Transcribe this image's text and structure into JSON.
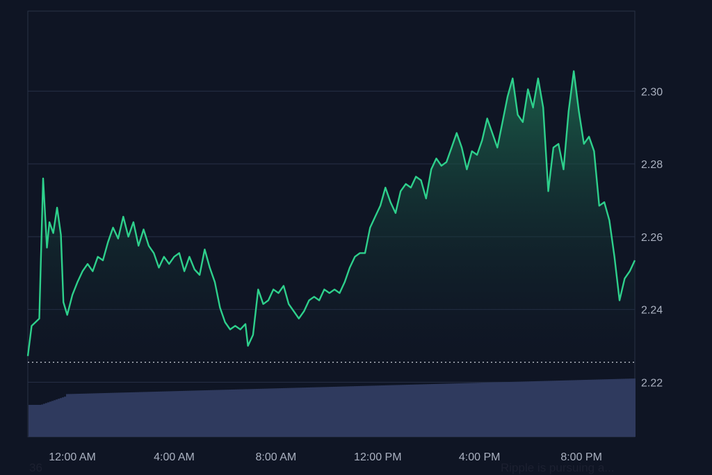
{
  "chart_data": {
    "type": "area",
    "title": "",
    "xlabel": "",
    "ylabel": "",
    "x_tick_labels": [
      "12:00 AM",
      "4:00 AM",
      "8:00 AM",
      "12:00 PM",
      "4:00 PM",
      "8:00 PM"
    ],
    "x_ticks_hours": [
      0,
      4,
      8,
      12,
      16,
      20
    ],
    "x_range_hours": [
      -1.75,
      22.1
    ],
    "ylim": [
      2.205,
      2.322
    ],
    "y_ticks": [
      "2.22",
      "2.24",
      "2.26",
      "2.28",
      "2.30"
    ],
    "y_tick_values": [
      2.22,
      2.24,
      2.26,
      2.28,
      2.3
    ],
    "reference_line": 2.2255,
    "grid": "horizontal",
    "line_color": "#2ed08c",
    "area_color": "#1a5a44",
    "volume_color": "#2f3a5e",
    "series": [
      {
        "values": [
          [
            -1.75,
            2.2272
          ],
          [
            -1.6,
            2.2355
          ],
          [
            -1.45,
            2.2365
          ],
          [
            -1.3,
            2.2375
          ],
          [
            -1.15,
            2.276
          ],
          [
            -1.0,
            2.257
          ],
          [
            -0.9,
            2.264
          ],
          [
            -0.75,
            2.261
          ],
          [
            -0.6,
            2.268
          ],
          [
            -0.45,
            2.2605
          ],
          [
            -0.35,
            2.242
          ],
          [
            -0.2,
            2.2385
          ],
          [
            0.0,
            2.244
          ],
          [
            0.2,
            2.2475
          ],
          [
            0.4,
            2.2505
          ],
          [
            0.6,
            2.2525
          ],
          [
            0.8,
            2.2505
          ],
          [
            1.0,
            2.2545
          ],
          [
            1.2,
            2.2535
          ],
          [
            1.4,
            2.2585
          ],
          [
            1.6,
            2.2625
          ],
          [
            1.8,
            2.2595
          ],
          [
            2.0,
            2.2655
          ],
          [
            2.2,
            2.26
          ],
          [
            2.4,
            2.264
          ],
          [
            2.6,
            2.2575
          ],
          [
            2.8,
            2.262
          ],
          [
            3.0,
            2.2575
          ],
          [
            3.2,
            2.2555
          ],
          [
            3.4,
            2.2515
          ],
          [
            3.6,
            2.2545
          ],
          [
            3.8,
            2.2525
          ],
          [
            4.0,
            2.2545
          ],
          [
            4.2,
            2.2555
          ],
          [
            4.4,
            2.2505
          ],
          [
            4.6,
            2.2545
          ],
          [
            4.8,
            2.251
          ],
          [
            5.0,
            2.2495
          ],
          [
            5.2,
            2.2565
          ],
          [
            5.4,
            2.2515
          ],
          [
            5.6,
            2.2475
          ],
          [
            5.8,
            2.2405
          ],
          [
            6.0,
            2.2365
          ],
          [
            6.2,
            2.2345
          ],
          [
            6.4,
            2.2355
          ],
          [
            6.6,
            2.2345
          ],
          [
            6.8,
            2.236
          ],
          [
            6.9,
            2.23
          ],
          [
            7.1,
            2.233
          ],
          [
            7.3,
            2.2455
          ],
          [
            7.5,
            2.2415
          ],
          [
            7.7,
            2.2425
          ],
          [
            7.9,
            2.2455
          ],
          [
            8.1,
            2.2445
          ],
          [
            8.3,
            2.2465
          ],
          [
            8.5,
            2.2415
          ],
          [
            8.7,
            2.2395
          ],
          [
            8.9,
            2.2375
          ],
          [
            9.1,
            2.2395
          ],
          [
            9.3,
            2.2425
          ],
          [
            9.5,
            2.2435
          ],
          [
            9.7,
            2.2425
          ],
          [
            9.9,
            2.2455
          ],
          [
            10.1,
            2.2445
          ],
          [
            10.3,
            2.2455
          ],
          [
            10.5,
            2.2445
          ],
          [
            10.7,
            2.2475
          ],
          [
            10.9,
            2.2515
          ],
          [
            11.1,
            2.2545
          ],
          [
            11.3,
            2.2555
          ],
          [
            11.5,
            2.2555
          ],
          [
            11.7,
            2.2625
          ],
          [
            11.9,
            2.2655
          ],
          [
            12.1,
            2.2685
          ],
          [
            12.3,
            2.2735
          ],
          [
            12.5,
            2.2695
          ],
          [
            12.7,
            2.2665
          ],
          [
            12.9,
            2.2725
          ],
          [
            13.1,
            2.2745
          ],
          [
            13.3,
            2.2735
          ],
          [
            13.5,
            2.2765
          ],
          [
            13.7,
            2.2755
          ],
          [
            13.9,
            2.2705
          ],
          [
            14.1,
            2.2785
          ],
          [
            14.3,
            2.2815
          ],
          [
            14.5,
            2.2795
          ],
          [
            14.7,
            2.2805
          ],
          [
            14.9,
            2.2845
          ],
          [
            15.1,
            2.2885
          ],
          [
            15.3,
            2.2845
          ],
          [
            15.5,
            2.2785
          ],
          [
            15.7,
            2.2835
          ],
          [
            15.9,
            2.2825
          ],
          [
            16.1,
            2.2865
          ],
          [
            16.3,
            2.2925
          ],
          [
            16.5,
            2.2885
          ],
          [
            16.7,
            2.2845
          ],
          [
            16.9,
            2.2915
          ],
          [
            17.1,
            2.2985
          ],
          [
            17.3,
            2.3035
          ],
          [
            17.5,
            2.2935
          ],
          [
            17.7,
            2.2915
          ],
          [
            17.9,
            2.3005
          ],
          [
            18.1,
            2.2955
          ],
          [
            18.3,
            2.3035
          ],
          [
            18.5,
            2.2955
          ],
          [
            18.7,
            2.2725
          ],
          [
            18.9,
            2.2845
          ],
          [
            19.1,
            2.2855
          ],
          [
            19.3,
            2.2785
          ],
          [
            19.5,
            2.2945
          ],
          [
            19.7,
            2.3055
          ],
          [
            19.9,
            2.2945
          ],
          [
            20.1,
            2.2855
          ],
          [
            20.3,
            2.2875
          ],
          [
            20.5,
            2.2835
          ],
          [
            20.7,
            2.2685
          ],
          [
            20.9,
            2.2695
          ],
          [
            21.1,
            2.2645
          ],
          [
            21.3,
            2.2545
          ],
          [
            21.5,
            2.2425
          ],
          [
            21.7,
            2.2485
          ],
          [
            21.9,
            2.2505
          ],
          [
            22.1,
            2.2535
          ]
        ]
      }
    ]
  },
  "footer": {
    "left_text": "36",
    "right_text": "Ripple is pursuing a..."
  }
}
